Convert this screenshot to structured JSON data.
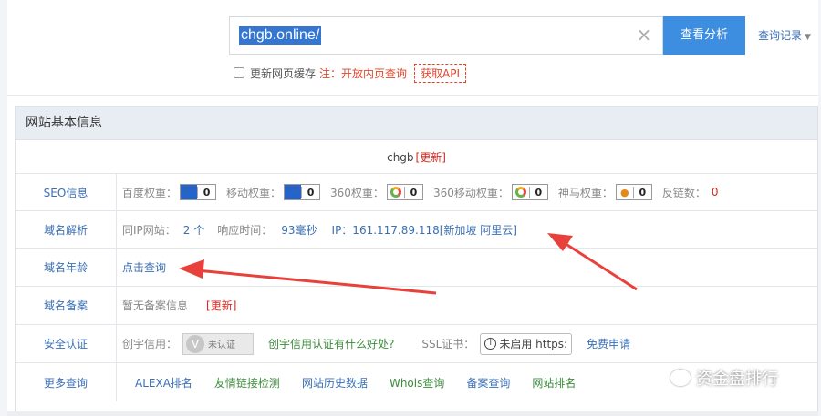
{
  "search": {
    "value": "chgb.online/",
    "clear_icon": "close-icon",
    "button_label": "查看分析",
    "history_label": "查询记录"
  },
  "cache": {
    "checkbox_label": "更新网页缓存",
    "note": "注：开放内页查询",
    "api_label": "获取API"
  },
  "panel": {
    "title": "网站基本信息",
    "site_name": "chgb",
    "site_update": "[更新]",
    "seo": {
      "label": "SEO信息",
      "baidu_label": "百度权重：",
      "baidu_value": "0",
      "mobile_label": "移动权重：",
      "mobile_value": "0",
      "w360_label": "360权重：",
      "w360_value": "0",
      "w360m_label": "360移动权重：",
      "w360m_value": "0",
      "shenma_label": "神马权重：",
      "shenma_value": "0",
      "backlink_label": "反链数：",
      "backlink_value": "0"
    },
    "dns": {
      "label": "域名解析",
      "same_ip_label": "同IP网站：",
      "same_ip_value": "2 个",
      "resp_label": "响应时间：",
      "resp_value": "93毫秒",
      "ip_text": "IP：161.117.89.118[新加坡 阿里云]"
    },
    "age": {
      "label": "域名年龄",
      "link": "点击查询"
    },
    "icp": {
      "label": "域名备案",
      "text": "暂无备案信息",
      "update": "[更新]"
    },
    "security": {
      "label": "安全认证",
      "credit_label": "创宇信用：",
      "cert_text": "未认证",
      "cert_v": "V",
      "credit_link": "创宇信用认证有什么好处?",
      "ssl_label": "SSL证书：",
      "ssl_value": "未启用 https:",
      "ssl_apply": "免费申请"
    },
    "more": {
      "label": "更多查询",
      "links": [
        "ALEXA排名",
        "友情链接检测",
        "网站历史数据",
        "Whois查询",
        "备案查询",
        "网站排名"
      ]
    }
  },
  "watermark": "资金盘排行",
  "colors": {
    "accent": "#3d8ee0",
    "link": "#3a6fb5",
    "warning": "#d9281e",
    "green_link": "#3c8b3c",
    "arrow": "#e8403a"
  }
}
